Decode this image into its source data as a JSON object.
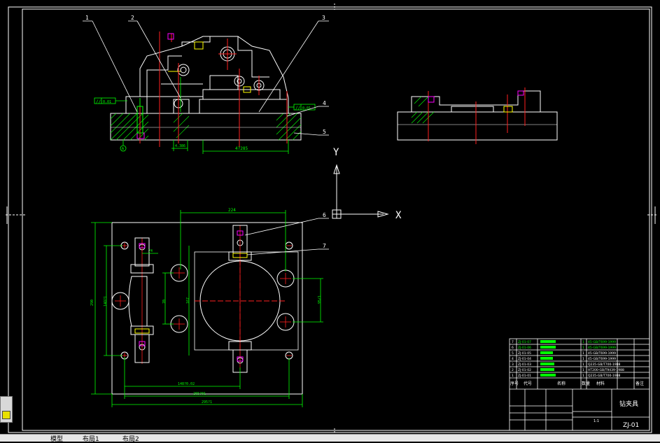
{
  "drawing": {
    "balloons": [
      "1",
      "2",
      "3",
      "4",
      "5",
      "6",
      "7"
    ],
    "datum_label": "A",
    "axis": {
      "y_label": "Y",
      "x_label": "X"
    }
  },
  "dimensions": {
    "front_width": "4?285",
    "front_small": "4.386",
    "plan_top": "224",
    "plan_left_outer": "290",
    "plan_left_inner": "14O?1",
    "plan_mid_vert": "70",
    "plan_hole_vert": "167",
    "plan_right_vert": "95/1",
    "plan_bot_1": "148?0.02",
    "plan_bot_2": "265?01",
    "plan_bot_3": "295?1",
    "plan_top_small": "74"
  },
  "tolerance_frames": [
    {
      "sym": "//",
      "val": "0.01",
      "ref": "A"
    },
    {
      "sym": "//",
      "val": "0.01",
      "ref": "A"
    }
  ],
  "title_block": {
    "rows": [
      {
        "no": "7",
        "code": "ZJ-01-07",
        "name": "",
        "qty": "1",
        "material": "45-GB/T699-1999"
      },
      {
        "no": "6",
        "code": "ZJ-01-06",
        "name": "",
        "qty": "1",
        "material": "45-GB/T699-1999"
      },
      {
        "no": "5",
        "code": "ZJ-01-05",
        "name": "",
        "qty": "1",
        "material": "45-GB/T699-1999"
      },
      {
        "no": "4",
        "code": "ZJ-01-04",
        "name": "",
        "qty": "1",
        "material": "45-GB/T699-1999"
      },
      {
        "no": "3",
        "code": "ZJ-01-03",
        "name": "",
        "qty": "1",
        "material": "Q235-GB/T700-1988"
      },
      {
        "no": "2",
        "code": "ZJ-01-02",
        "name": "",
        "qty": "1",
        "material": "HT200-GB/T9439-1988"
      },
      {
        "no": "1",
        "code": "ZJ-01-01",
        "name": "",
        "qty": "1",
        "material": "Q235-GB/T700-1988"
      }
    ],
    "header": {
      "no": "序号",
      "code": "代号",
      "name": "名称",
      "qty": "数量",
      "material": "材料",
      "remark": "备注"
    },
    "drawing_name": "钻夹具",
    "drawing_code": "ZJ-01",
    "scale": "1:1"
  },
  "status_bar": {
    "tabs": [
      "模型",
      "布局1",
      "布局2"
    ]
  },
  "colors": {
    "green": "#00ff00",
    "red": "#ff2020",
    "white": "#ffffff",
    "magenta": "#ff00ff",
    "yellow": "#ffff00",
    "background": "#000000"
  }
}
